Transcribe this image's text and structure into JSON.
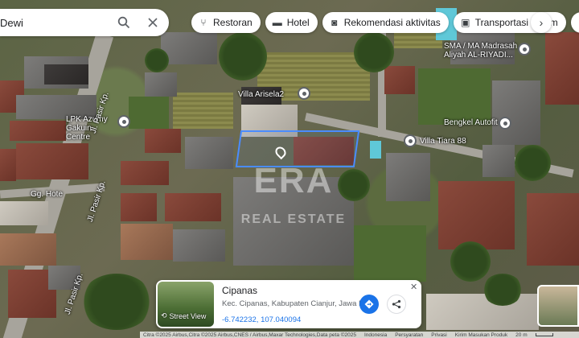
{
  "search": {
    "value": "Dewi"
  },
  "chips": [
    {
      "icon": "fork-knife-icon",
      "label": "Restoran"
    },
    {
      "icon": "bed-icon",
      "label": "Hotel"
    },
    {
      "icon": "camera-icon",
      "label": "Rekomendasi aktivitas"
    },
    {
      "icon": "train-icon",
      "label": "Transportasi umum"
    },
    {
      "icon": "parking-icon",
      "label": "Pa"
    }
  ],
  "map": {
    "places": [
      "Villa Arisela2",
      "LPK Azumy Gakuin Centre",
      "SMA / MA Madrasah Aliyah AL-RIYADI...",
      "Bengkel Autofit",
      "Villa Tiara 88",
      "Gg. Hote"
    ],
    "roads": [
      "Jl. Pasir Kp.",
      "Jl. Pasir Kp.",
      "Jl. Pasir Kp."
    ],
    "watermark": {
      "logo": "ERA",
      "text": "REAL ESTATE"
    }
  },
  "card": {
    "title": "Cipanas",
    "address": "Kec. Cipanas, Kabupaten Cianjur, Jawa Barat",
    "coordinates": "-6.742232, 107.040094",
    "street_view_label": "Street View"
  },
  "footer": {
    "attribution": "Citra ©2025 Airbus,Citra ©2025 Airbus,CNES / Airbus,Maxar Technologies,Data peta ©2025",
    "links": [
      "Indonesia",
      "Persyaratan",
      "Privasi",
      "Kirim Masukan Produk"
    ],
    "scale": "20 m"
  }
}
